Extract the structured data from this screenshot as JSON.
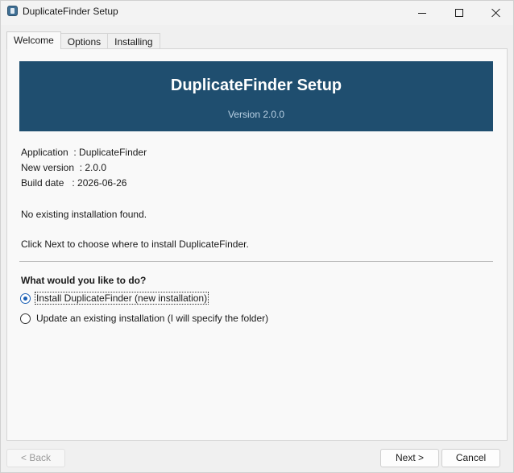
{
  "window": {
    "title": "DuplicateFinder Setup",
    "app_icon": "installer-icon"
  },
  "tabs": [
    {
      "label": "Welcome",
      "active": true
    },
    {
      "label": "Options",
      "active": false
    },
    {
      "label": "Installing",
      "active": false
    }
  ],
  "banner": {
    "title": "DuplicateFinder Setup",
    "version": "Version 2.0.0",
    "color": "#1f4e6f"
  },
  "info": {
    "application": "Application  : DuplicateFinder",
    "new_version": "New version  : 2.0.0",
    "build_date": "Build date   : 2026-06-26",
    "status": "No existing installation found.",
    "instruction": "Click Next to choose where to install DuplicateFinder."
  },
  "question": "What would you like to do?",
  "options": [
    {
      "label": "Install DuplicateFinder (new installation)",
      "checked": true
    },
    {
      "label": "Update an existing installation (I will specify the folder)",
      "checked": false
    }
  ],
  "buttons": {
    "back": "< Back",
    "next": "Next >",
    "cancel": "Cancel"
  }
}
